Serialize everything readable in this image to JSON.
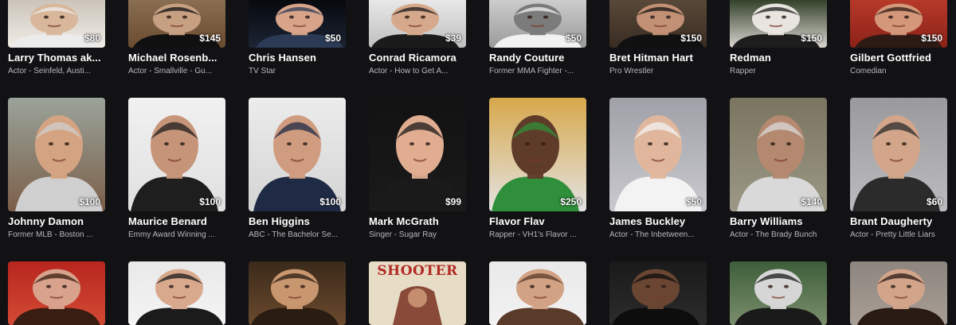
{
  "rows": [
    {
      "cards": [
        {
          "name": "Larry Thomas ak...",
          "subtitle": "Actor - Seinfeld, Austi...",
          "price": "$80"
        },
        {
          "name": "Michael Rosenb...",
          "subtitle": "Actor - Smallville - Gu...",
          "price": "$145"
        },
        {
          "name": "Chris Hansen",
          "subtitle": "TV Star",
          "price": "$50"
        },
        {
          "name": "Conrad Ricamora",
          "subtitle": "Actor - How to Get A...",
          "price": "$39"
        },
        {
          "name": "Randy Couture",
          "subtitle": "Former MMA Fighter -...",
          "price": "$50"
        },
        {
          "name": "Bret Hitman Hart",
          "subtitle": "Pro Wrestler",
          "price": "$150"
        },
        {
          "name": "Redman",
          "subtitle": "Rapper",
          "price": "$150"
        },
        {
          "name": "Gilbert Gottfried",
          "subtitle": "Comedian",
          "price": "$150"
        }
      ]
    },
    {
      "cards": [
        {
          "name": "Johnny Damon",
          "subtitle": "Former MLB - Boston ...",
          "price": "$100"
        },
        {
          "name": "Maurice Benard",
          "subtitle": "Emmy Award Winning ...",
          "price": "$100"
        },
        {
          "name": "Ben Higgins",
          "subtitle": "ABC - The Bachelor Se...",
          "price": "$100"
        },
        {
          "name": "Mark McGrath",
          "subtitle": "Singer - Sugar Ray",
          "price": "$99"
        },
        {
          "name": "Flavor Flav",
          "subtitle": "Rapper - VH1's Flavor ...",
          "price": "$250"
        },
        {
          "name": "James Buckley",
          "subtitle": "Actor - The Inbetween...",
          "price": "$50"
        },
        {
          "name": "Barry Williams",
          "subtitle": "Actor - The Brady Bunch",
          "price": "$140"
        },
        {
          "name": "Brant Daugherty",
          "subtitle": "Actor - Pretty Little Liars",
          "price": "$60"
        }
      ]
    },
    {
      "cards": [
        {},
        {},
        {},
        {
          "poster_text": "SHOOTER"
        },
        {},
        {},
        {},
        {}
      ]
    }
  ]
}
